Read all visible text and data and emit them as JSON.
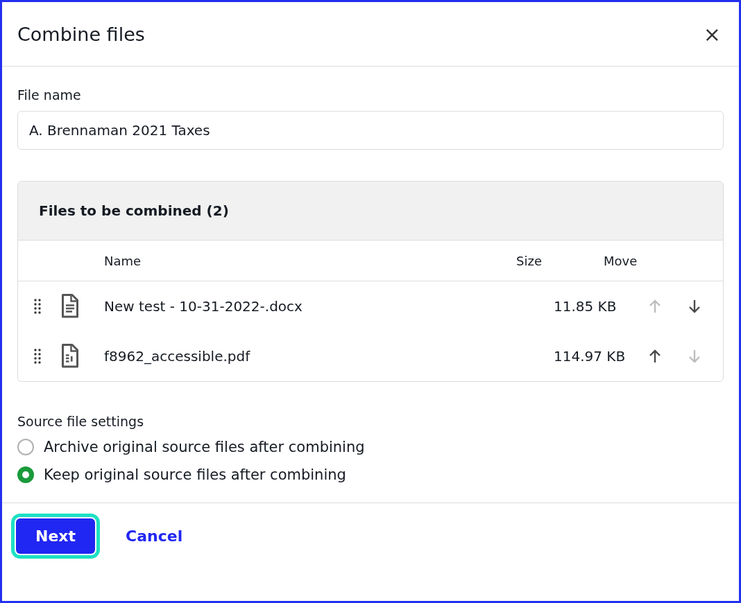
{
  "dialog": {
    "title": "Combine files",
    "close_label": "×"
  },
  "file_name": {
    "label": "File name",
    "value": "A. Brennaman 2021 Taxes"
  },
  "files_panel": {
    "title": "Files to be combined (2)",
    "columns": [
      "Name",
      "Size",
      "Move"
    ],
    "rows": [
      {
        "kind": "document",
        "name": "New test - 10-31-2022-.docx",
        "size": "11.85 KB",
        "up_disabled": true,
        "down_disabled": false
      },
      {
        "kind": "pdf",
        "name": "f8962_accessible.pdf",
        "size": "114.97 KB",
        "up_disabled": false,
        "down_disabled": true
      }
    ]
  },
  "source_settings": {
    "label": "Source file settings",
    "options": [
      {
        "label": "Archive original source files after combining",
        "selected": false
      },
      {
        "label": "Keep original source files after combining",
        "selected": true
      }
    ]
  },
  "footer": {
    "next": {
      "label": "Next",
      "focused": true
    },
    "cancel": {
      "label": "Cancel"
    }
  }
}
